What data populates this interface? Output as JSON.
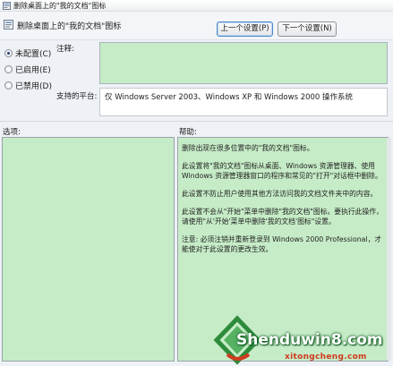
{
  "window": {
    "title": "删除桌面上的\"我的文档\"图标"
  },
  "header": {
    "policy_name": "删除桌面上的\"我的文档\"图标",
    "prev_button": "上一个设置(P)",
    "next_button": "下一个设置(N)"
  },
  "options": {
    "not_configured": "未配置(C)",
    "enabled": "已启用(E)",
    "disabled": "已禁用(D)",
    "selected": "not_configured"
  },
  "labels": {
    "comment": "注释:",
    "supported_on": "支持的平台:",
    "options": "选项:",
    "help": "帮助:"
  },
  "supported_on_value": "仅 Windows Server 2003、Windows XP 和 Windows 2000 操作系统",
  "help": {
    "paragraphs": [
      "删除出现在很多位置中的\"我的文档\"图标。",
      "此设置将\"我的文档\"图标从桌面、Windows 资源管理器、使用 Windows 资源管理器窗口的程序和常见的\"打开\"对话框中删除。",
      "此设置不防止用户使用其他方法访问我的文档文件夹中的内容。",
      "此设置不会从\"开始\"菜单中删除\"我的文档\"图标。要执行此操作，请使用\"从'开始'菜单中删除'我的文档'图标\"设置。",
      "注意: 必须注销并重新登录到 Windows 2000 Professional，才能使对于此设置的更改生效。"
    ]
  },
  "watermark": {
    "brand": "Shenduwin8.com",
    "site": "xitongcheng.com"
  },
  "colors": {
    "pane_bg": "#c6ecc7",
    "window_bg": "#eef1f5"
  }
}
